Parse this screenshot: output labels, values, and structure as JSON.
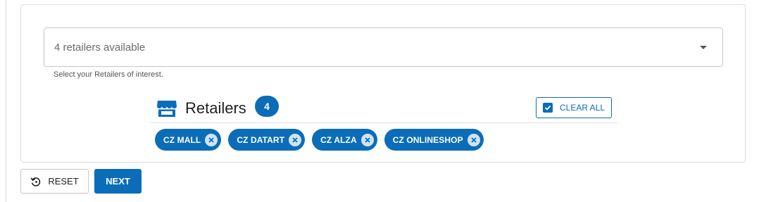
{
  "retailer_select": {
    "value": "4 retailers available",
    "helper_text": "Select your Retailers of interest."
  },
  "retailers_panel": {
    "title": "Retailers",
    "count": "4",
    "clear_all_label": "CLEAR ALL",
    "chips": [
      {
        "label": "CZ MALL"
      },
      {
        "label": "CZ DATART"
      },
      {
        "label": "CZ ALZA"
      },
      {
        "label": "CZ ONLINESHOP"
      }
    ]
  },
  "actions": {
    "reset_label": "RESET",
    "next_label": "NEXT"
  },
  "colors": {
    "primary": "#0b6db7",
    "chip_remove_bg": "#cfe3f3",
    "border": "#c6c6c6"
  },
  "icons": {
    "store": "store-icon",
    "dropdown": "caret-down-icon",
    "checkbox": "checkbox-checked-icon",
    "chip_remove": "close-circle-icon",
    "reset": "reset-icon"
  }
}
